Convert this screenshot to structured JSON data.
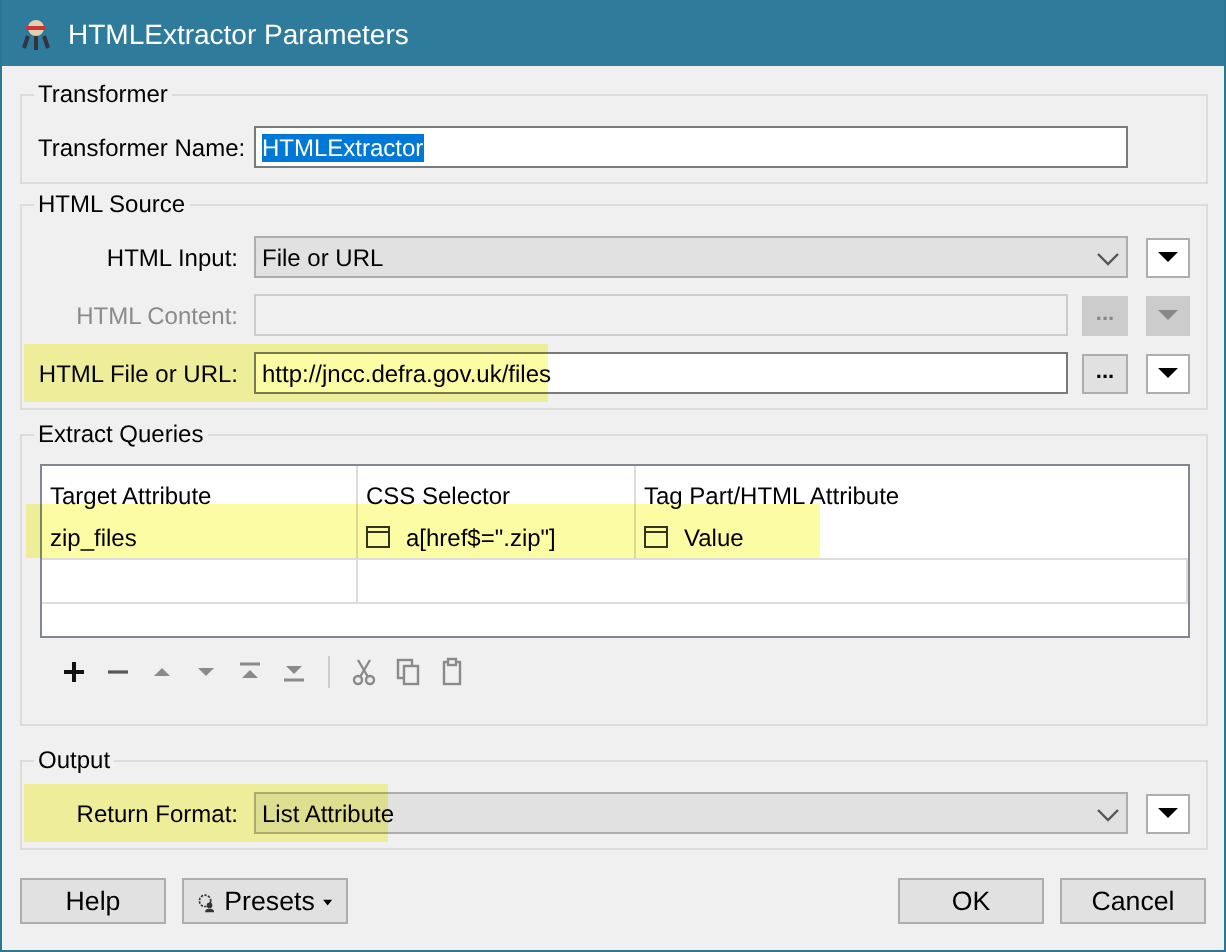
{
  "window": {
    "title": "HTMLExtractor Parameters"
  },
  "transformer": {
    "title": "Transformer",
    "fields": [
      {
        "label": "Transformer Name:",
        "kind": "text",
        "value": "HTMLExtractor",
        "text_selected": true,
        "disabled": false,
        "highlighted": false
      }
    ]
  },
  "html_source": {
    "title": "HTML Source",
    "fields": [
      {
        "label": "HTML Input:",
        "kind": "dropdown",
        "value": "File or URL",
        "disabled": false,
        "highlighted": false
      },
      {
        "label": "HTML Content:",
        "kind": "text_browse",
        "browse_label": "...",
        "disabled": true,
        "highlighted": false
      },
      {
        "label": "HTML File or URL:",
        "kind": "text_browse",
        "value": "http://jncc.defra.gov.uk/files",
        "browse_label": "...",
        "disabled": false,
        "highlighted": true
      }
    ]
  },
  "extract_queries": {
    "title": "Extract Queries",
    "table": {
      "columns": [
        "Target Attribute",
        "CSS Selector",
        "Tag Part/HTML Attribute"
      ],
      "rows": [
        {
          "highlighted": true,
          "cells": [
            {
              "kind": "plain",
              "text": "zip_files"
            },
            {
              "kind": "expression",
              "text": "a[href$=\".zip\"]"
            },
            {
              "kind": "expression",
              "text": "Value"
            }
          ]
        }
      ]
    },
    "toolbar": [
      {
        "kind": "add",
        "disabled": false
      },
      {
        "kind": "remove",
        "disabled": false
      },
      {
        "kind": "up",
        "disabled": true
      },
      {
        "kind": "down",
        "disabled": true
      },
      {
        "kind": "top",
        "disabled": true
      },
      {
        "kind": "bottom",
        "disabled": true
      },
      {
        "kind": "cut",
        "disabled": true
      },
      {
        "kind": "copy",
        "disabled": true
      },
      {
        "kind": "paste",
        "disabled": true
      }
    ]
  },
  "output": {
    "title": "Output",
    "fields": [
      {
        "label": "Return Format:",
        "kind": "dropdown",
        "value": "List Attribute",
        "disabled": false,
        "highlighted": true
      }
    ]
  },
  "left_buttons": [
    {
      "label": "Help",
      "kind": "plain"
    },
    {
      "label": "Presets",
      "kind": "menu"
    }
  ],
  "right_buttons": [
    {
      "label": "OK",
      "kind": "plain"
    },
    {
      "label": "Cancel",
      "kind": "plain"
    }
  ]
}
